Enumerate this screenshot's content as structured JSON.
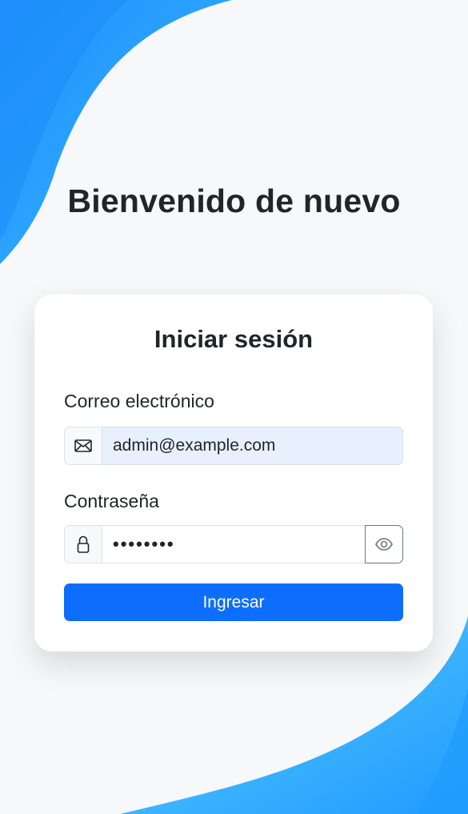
{
  "page": {
    "welcome_heading": "Bienvenido de nuevo",
    "background_accent": "#1e90ff",
    "background_light_accent": "#4fc3f7"
  },
  "login_card": {
    "title": "Iniciar sesión",
    "email": {
      "label": "Correo electrónico",
      "value": "admin@example.com",
      "icon": "envelope-icon"
    },
    "password": {
      "label": "Contraseña",
      "masked_value": "••••••••",
      "icon": "lock-icon",
      "toggle_icon": "eye-icon"
    },
    "submit_label": "Ingresar",
    "submit_color": "#0d6efd"
  }
}
